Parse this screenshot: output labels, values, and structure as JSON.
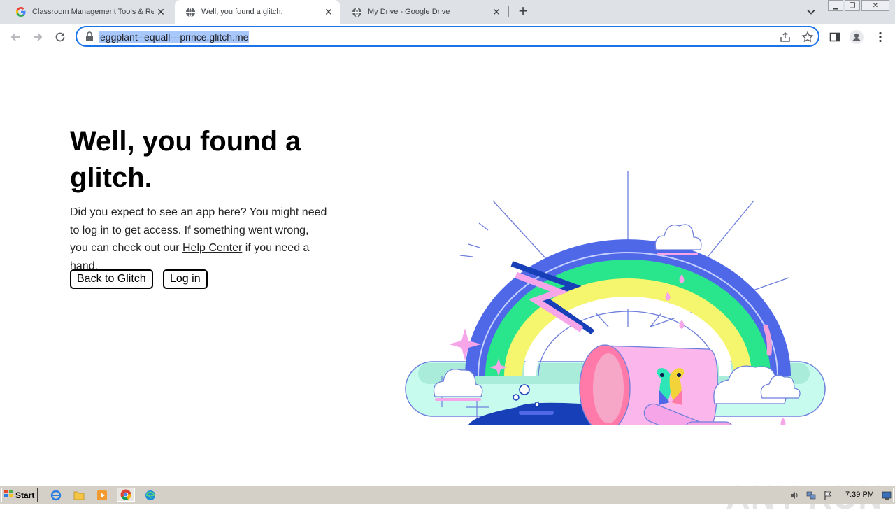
{
  "browser": {
    "tabs": [
      {
        "title": "Classroom Management Tools & Resc",
        "favicon": "google-g-icon",
        "active": false
      },
      {
        "title": "Well, you found a glitch.",
        "favicon": "globe-icon",
        "active": true
      },
      {
        "title": "My Drive - Google Drive",
        "favicon": "globe-icon",
        "active": false
      }
    ],
    "new_tab": "+",
    "url": "eggplant--equall---prince.glitch.me"
  },
  "page": {
    "heading": "Well, you found a glitch.",
    "desc_before": "Did you expect to see an app here? You might need to log in to get access. If something went wrong, you can check out our ",
    "help_link": "Help Center",
    "desc_after": " if you need a hand.",
    "back_button": "Back to Glitch",
    "login_button": "Log in"
  },
  "watermark": "ANY RUN",
  "taskbar": {
    "start_label": "Start",
    "clock": "7:39 PM"
  },
  "colors": {
    "accent": "#1a73e8",
    "url_highlight": "#a8c7fa",
    "tabstrip": "#dee1e6",
    "taskbar": "#d4d0c8"
  }
}
